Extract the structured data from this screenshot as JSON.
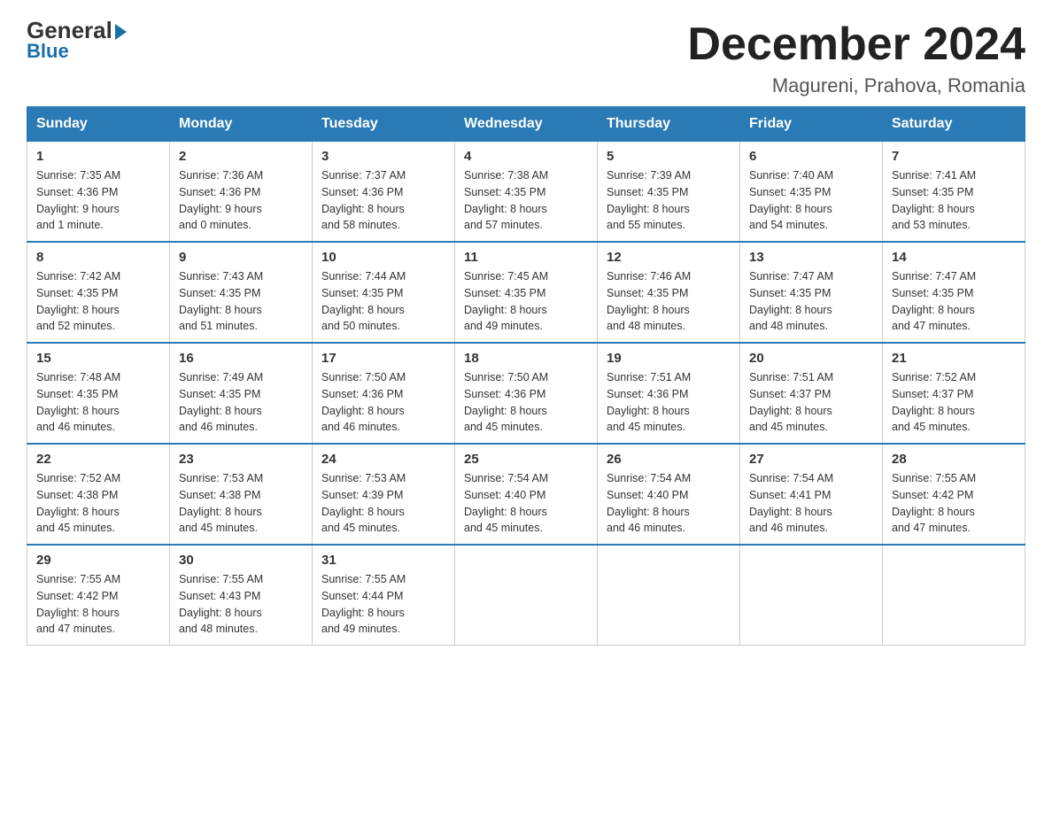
{
  "logo": {
    "line1": "General",
    "line2": "Blue"
  },
  "title": "December 2024",
  "subtitle": "Magureni, Prahova, Romania",
  "weekdays": [
    "Sunday",
    "Monday",
    "Tuesday",
    "Wednesday",
    "Thursday",
    "Friday",
    "Saturday"
  ],
  "weeks": [
    [
      {
        "day": "1",
        "sunrise": "7:35 AM",
        "sunset": "4:36 PM",
        "daylight": "9 hours and 1 minute."
      },
      {
        "day": "2",
        "sunrise": "7:36 AM",
        "sunset": "4:36 PM",
        "daylight": "9 hours and 0 minutes."
      },
      {
        "day": "3",
        "sunrise": "7:37 AM",
        "sunset": "4:36 PM",
        "daylight": "8 hours and 58 minutes."
      },
      {
        "day": "4",
        "sunrise": "7:38 AM",
        "sunset": "4:35 PM",
        "daylight": "8 hours and 57 minutes."
      },
      {
        "day": "5",
        "sunrise": "7:39 AM",
        "sunset": "4:35 PM",
        "daylight": "8 hours and 55 minutes."
      },
      {
        "day": "6",
        "sunrise": "7:40 AM",
        "sunset": "4:35 PM",
        "daylight": "8 hours and 54 minutes."
      },
      {
        "day": "7",
        "sunrise": "7:41 AM",
        "sunset": "4:35 PM",
        "daylight": "8 hours and 53 minutes."
      }
    ],
    [
      {
        "day": "8",
        "sunrise": "7:42 AM",
        "sunset": "4:35 PM",
        "daylight": "8 hours and 52 minutes."
      },
      {
        "day": "9",
        "sunrise": "7:43 AM",
        "sunset": "4:35 PM",
        "daylight": "8 hours and 51 minutes."
      },
      {
        "day": "10",
        "sunrise": "7:44 AM",
        "sunset": "4:35 PM",
        "daylight": "8 hours and 50 minutes."
      },
      {
        "day": "11",
        "sunrise": "7:45 AM",
        "sunset": "4:35 PM",
        "daylight": "8 hours and 49 minutes."
      },
      {
        "day": "12",
        "sunrise": "7:46 AM",
        "sunset": "4:35 PM",
        "daylight": "8 hours and 48 minutes."
      },
      {
        "day": "13",
        "sunrise": "7:47 AM",
        "sunset": "4:35 PM",
        "daylight": "8 hours and 48 minutes."
      },
      {
        "day": "14",
        "sunrise": "7:47 AM",
        "sunset": "4:35 PM",
        "daylight": "8 hours and 47 minutes."
      }
    ],
    [
      {
        "day": "15",
        "sunrise": "7:48 AM",
        "sunset": "4:35 PM",
        "daylight": "8 hours and 46 minutes."
      },
      {
        "day": "16",
        "sunrise": "7:49 AM",
        "sunset": "4:35 PM",
        "daylight": "8 hours and 46 minutes."
      },
      {
        "day": "17",
        "sunrise": "7:50 AM",
        "sunset": "4:36 PM",
        "daylight": "8 hours and 46 minutes."
      },
      {
        "day": "18",
        "sunrise": "7:50 AM",
        "sunset": "4:36 PM",
        "daylight": "8 hours and 45 minutes."
      },
      {
        "day": "19",
        "sunrise": "7:51 AM",
        "sunset": "4:36 PM",
        "daylight": "8 hours and 45 minutes."
      },
      {
        "day": "20",
        "sunrise": "7:51 AM",
        "sunset": "4:37 PM",
        "daylight": "8 hours and 45 minutes."
      },
      {
        "day": "21",
        "sunrise": "7:52 AM",
        "sunset": "4:37 PM",
        "daylight": "8 hours and 45 minutes."
      }
    ],
    [
      {
        "day": "22",
        "sunrise": "7:52 AM",
        "sunset": "4:38 PM",
        "daylight": "8 hours and 45 minutes."
      },
      {
        "day": "23",
        "sunrise": "7:53 AM",
        "sunset": "4:38 PM",
        "daylight": "8 hours and 45 minutes."
      },
      {
        "day": "24",
        "sunrise": "7:53 AM",
        "sunset": "4:39 PM",
        "daylight": "8 hours and 45 minutes."
      },
      {
        "day": "25",
        "sunrise": "7:54 AM",
        "sunset": "4:40 PM",
        "daylight": "8 hours and 45 minutes."
      },
      {
        "day": "26",
        "sunrise": "7:54 AM",
        "sunset": "4:40 PM",
        "daylight": "8 hours and 46 minutes."
      },
      {
        "day": "27",
        "sunrise": "7:54 AM",
        "sunset": "4:41 PM",
        "daylight": "8 hours and 46 minutes."
      },
      {
        "day": "28",
        "sunrise": "7:55 AM",
        "sunset": "4:42 PM",
        "daylight": "8 hours and 47 minutes."
      }
    ],
    [
      {
        "day": "29",
        "sunrise": "7:55 AM",
        "sunset": "4:42 PM",
        "daylight": "8 hours and 47 minutes."
      },
      {
        "day": "30",
        "sunrise": "7:55 AM",
        "sunset": "4:43 PM",
        "daylight": "8 hours and 48 minutes."
      },
      {
        "day": "31",
        "sunrise": "7:55 AM",
        "sunset": "4:44 PM",
        "daylight": "8 hours and 49 minutes."
      },
      null,
      null,
      null,
      null
    ]
  ],
  "labels": {
    "sunrise": "Sunrise:",
    "sunset": "Sunset:",
    "daylight": "Daylight:"
  }
}
